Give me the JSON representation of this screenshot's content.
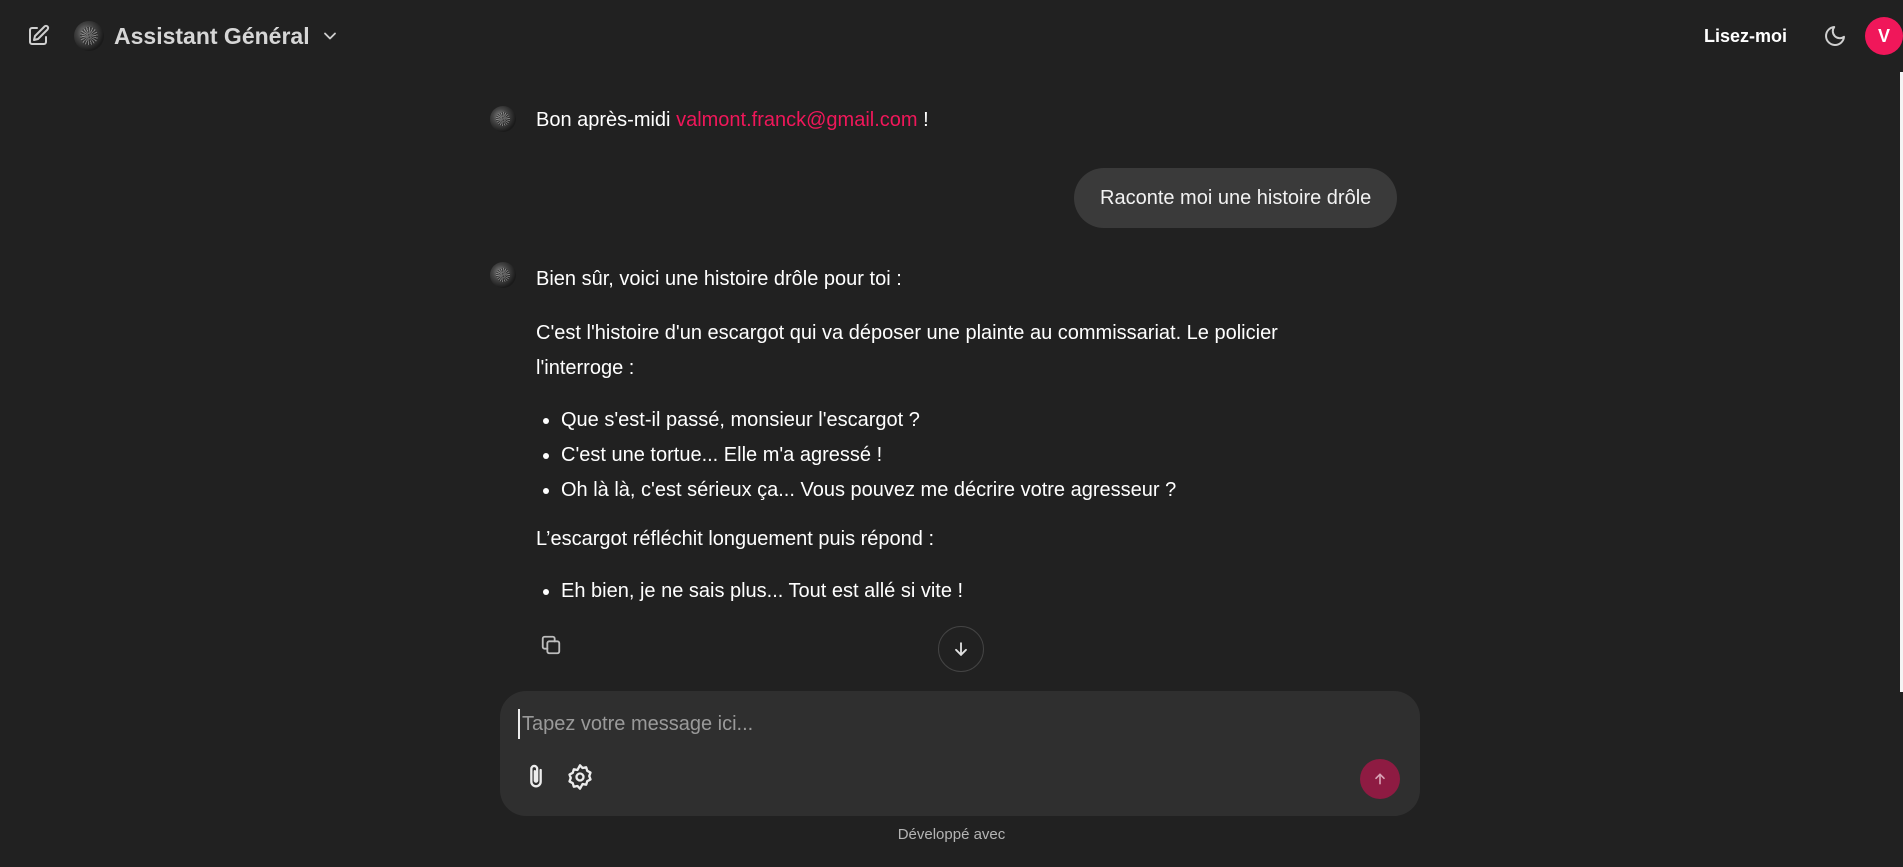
{
  "header": {
    "model_name": "Assistant Général",
    "readme_label": "Lisez-moi",
    "user_initial": "V",
    "icons": {
      "new_chat": "edit-icon",
      "model_dropdown": "chevron-down-icon",
      "theme": "moon-icon"
    }
  },
  "colors": {
    "background": "#212121",
    "accent": "#f0175a",
    "send_button": "#8e1b42",
    "user_bubble": "#3a3a3a",
    "composer": "#2f2f2f"
  },
  "chat": {
    "greeting_prefix": "Bon après-midi",
    "greeting_email": "valmont.franck@gmail.com",
    "greeting_suffix": " !",
    "user_message": "Raconte moi une histoire drôle",
    "reply": {
      "intro": "Bien sûr, voici une histoire drôle pour toi :",
      "paragraph1": "C'est l'histoire d'un escargot qui va déposer une plainte au commissariat. Le policier l'interroge :",
      "list1": [
        "Que s'est-il passé, monsieur l'escargot ?",
        "C'est une tortue... Elle m'a agressé !",
        "Oh là là, c'est sérieux ça... Vous pouvez me décrire votre agresseur ?"
      ],
      "paragraph2": "L’escargot réfléchit longuement puis répond :",
      "list2": [
        "Eh bien, je ne sais plus... Tout est allé si vite !"
      ]
    }
  },
  "composer": {
    "placeholder": "Tapez votre message ici...",
    "value": "",
    "icons": {
      "attach": "paperclip-icon",
      "settings": "gear-icon",
      "send": "arrow-up-icon"
    }
  },
  "footer": {
    "text": "Développé avec"
  }
}
